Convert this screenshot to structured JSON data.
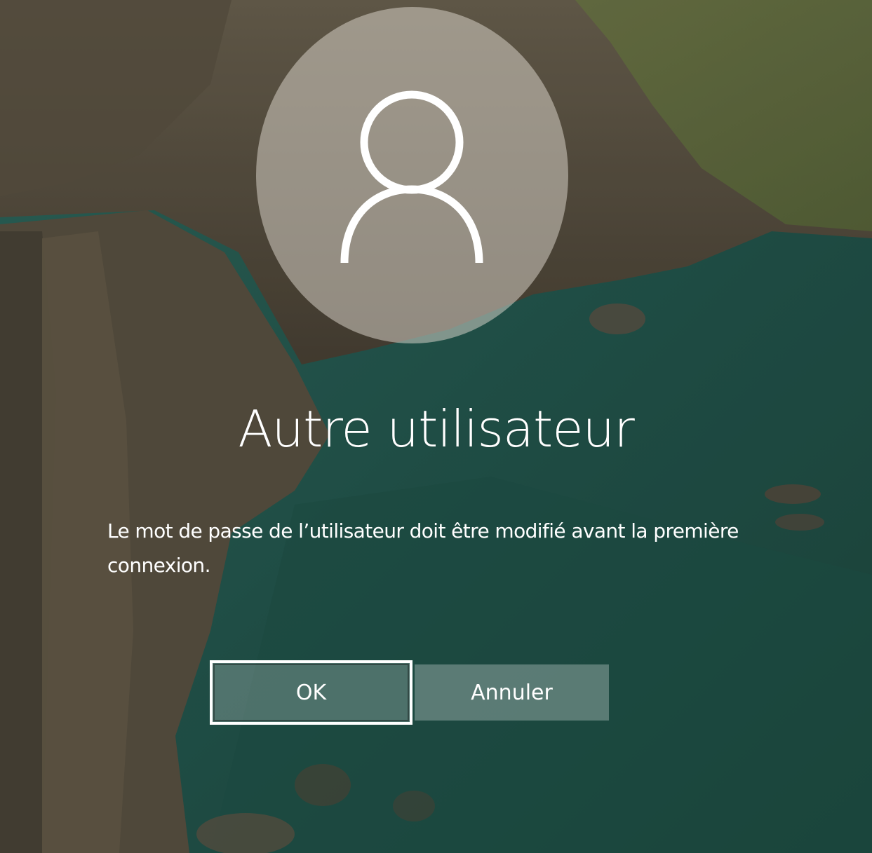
{
  "screen": {
    "title": "Autre utilisateur",
    "message": "Le mot de passe de l’utilisateur doit être modifié avant la première connexion.",
    "avatar_icon": "user-icon"
  },
  "buttons": {
    "ok_label": "OK",
    "cancel_label": "Annuler"
  },
  "colors": {
    "text": "#ffffff",
    "button_fill": "rgba(255,255,255,0.25)",
    "focus_border": "#ffffff"
  }
}
